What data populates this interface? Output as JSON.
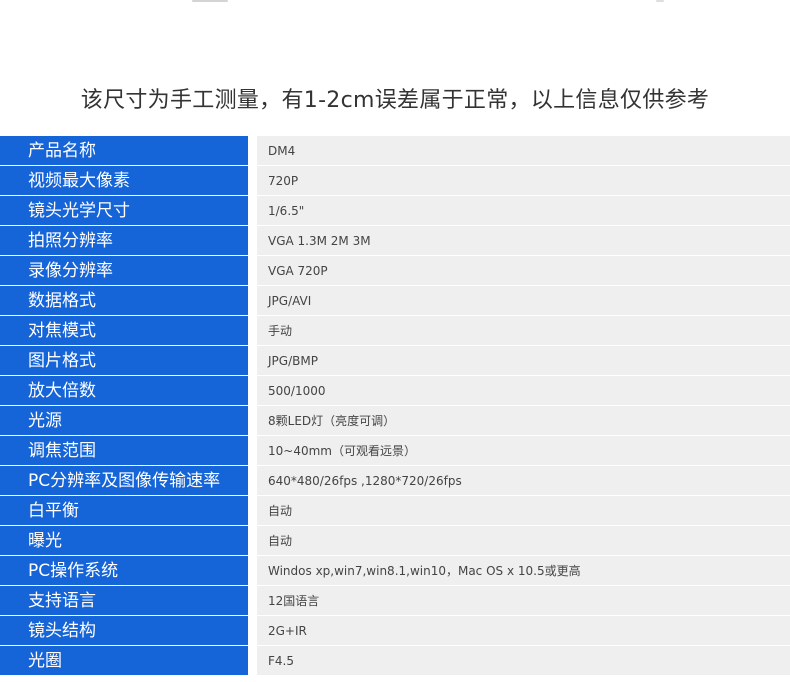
{
  "notice": "该尺寸为手工测量，有1-2cm误差属于正常，以上信息仅供参考",
  "specs": [
    {
      "label": "产品名称",
      "value": "DM4"
    },
    {
      "label": "视频最大像素",
      "value": "720P"
    },
    {
      "label": "镜头光学尺寸",
      "value": "1/6.5\""
    },
    {
      "label": "拍照分辨率",
      "value": "VGA  1.3M  2M  3M"
    },
    {
      "label": "录像分辨率",
      "value": "VGA   720P"
    },
    {
      "label": "数据格式",
      "value": "JPG/AVI"
    },
    {
      "label": "对焦模式",
      "value": "手动"
    },
    {
      "label": "图片格式",
      "value": "JPG/BMP"
    },
    {
      "label": "放大倍数",
      "value": "500/1000"
    },
    {
      "label": "光源",
      "value": "8颗LED灯（亮度可调）"
    },
    {
      "label": "调焦范围",
      "value": "10~40mm（可观看远景）"
    },
    {
      "label": "PC分辨率及图像传输速率",
      "value": "640*480/26fps ,1280*720/26fps"
    },
    {
      "label": "白平衡",
      "value": "自动"
    },
    {
      "label": "曝光",
      "value": "自动"
    },
    {
      "label": "PC操作系统",
      "value": "Windos xp,win7,win8.1,win10，Mac OS x 10.5或更高"
    },
    {
      "label": "支持语言",
      "value": "12国语言"
    },
    {
      "label": "镜头结构",
      "value": "2G+IR"
    },
    {
      "label": "光圈",
      "value": "F4.5"
    }
  ],
  "colors": {
    "label_bg": "#1564d8",
    "value_bg": "#efefef",
    "notice_text": "#333333"
  }
}
